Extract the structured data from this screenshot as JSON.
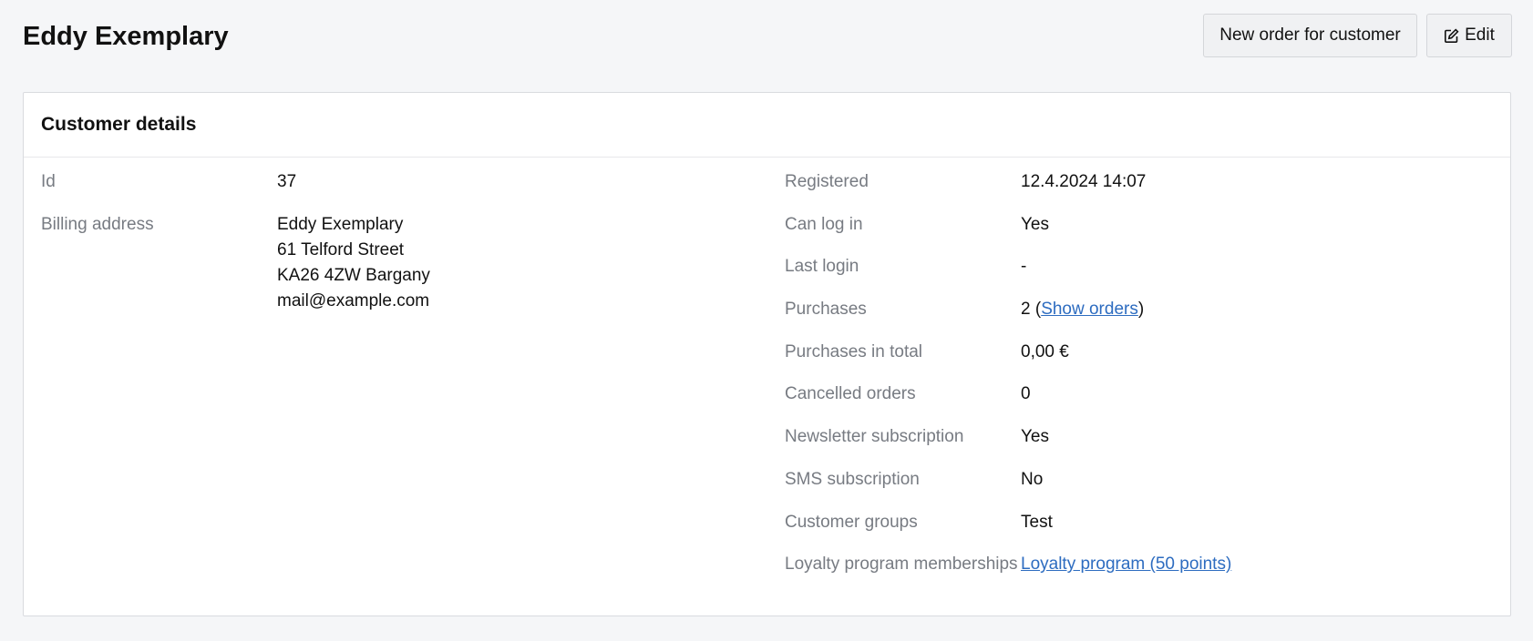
{
  "header": {
    "title": "Eddy Exemplary",
    "new_order_label": "New order for customer",
    "edit_label": "Edit"
  },
  "card": {
    "title": "Customer details"
  },
  "left": {
    "id_label": "Id",
    "id_value": "37",
    "billing_label": "Billing address",
    "billing_lines": [
      "Eddy Exemplary",
      "61 Telford Street",
      "KA26 4ZW Bargany",
      "mail@example.com"
    ]
  },
  "right": {
    "registered_label": "Registered",
    "registered_value": "12.4.2024 14:07",
    "can_login_label": "Can log in",
    "can_login_value": "Yes",
    "last_login_label": "Last login",
    "last_login_value": "-",
    "purchases_label": "Purchases",
    "purchases_count": "2",
    "purchases_open": " (",
    "purchases_link": "Show orders",
    "purchases_close": ")",
    "purchases_total_label": "Purchases in total",
    "purchases_total_value": "0,00 €",
    "cancelled_label": "Cancelled orders",
    "cancelled_value": "0",
    "newsletter_label": "Newsletter subscription",
    "newsletter_value": "Yes",
    "sms_label": "SMS subscription",
    "sms_value": "No",
    "groups_label": "Customer groups",
    "groups_value": "Test",
    "loyalty_label": "Loyalty program memberships",
    "loyalty_link": "Loyalty program (50 points)"
  },
  "icons": {
    "edit": "edit-icon"
  },
  "colors": {
    "link": "#2d6cc0",
    "label": "#777b82",
    "background": "#f5f6f8"
  }
}
